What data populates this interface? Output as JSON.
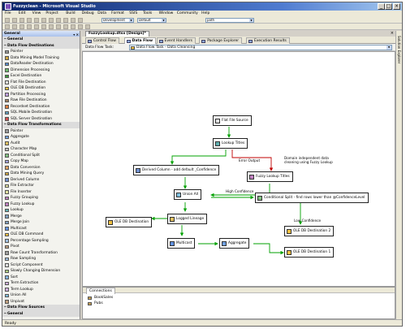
{
  "window": {
    "title": "Fuzzyclean - Microsoft Visual Studio",
    "controls": [
      "_",
      "□",
      "×"
    ]
  },
  "menu": [
    "File",
    "Edit",
    "View",
    "Project",
    "Build",
    "Debug",
    "Data",
    "Format",
    "SSIS",
    "Tools",
    "Window",
    "Community",
    "Help"
  ],
  "toolbar": {
    "config": "Development",
    "platform": "Default",
    "find": "path"
  },
  "toolbox": {
    "title": "General",
    "items": [
      {
        "label": "General",
        "group": true,
        "sign": "−",
        "color": ""
      },
      {
        "label": "Data Flow Destinations",
        "group": true,
        "sign": "−",
        "color": ""
      },
      {
        "label": "Pointer",
        "group": false,
        "color": "#9a9a9a"
      },
      {
        "label": "Data Mining Model Training",
        "group": false,
        "color": "#d0a640"
      },
      {
        "label": "DataReader Destination",
        "group": false,
        "color": "#5a8fd0"
      },
      {
        "label": "Dimension Processing",
        "group": false,
        "color": "#6bbb6b"
      },
      {
        "label": "Excel Destination",
        "group": false,
        "color": "#3c9c3c"
      },
      {
        "label": "Flat File Destination",
        "group": false,
        "color": "#e0e0e0"
      },
      {
        "label": "OLE DB Destination",
        "group": false,
        "color": "#f0c040"
      },
      {
        "label": "Partition Processing",
        "group": false,
        "color": "#c0a0e0"
      },
      {
        "label": "Raw File Destination",
        "group": false,
        "color": "#a08060"
      },
      {
        "label": "Recordset Destination",
        "group": false,
        "color": "#e08040"
      },
      {
        "label": "SQL Mobile Destination",
        "group": false,
        "color": "#60a0c0"
      },
      {
        "label": "SQL Server Destination",
        "group": false,
        "color": "#d05050"
      },
      {
        "label": "Data Flow Transformations",
        "group": true,
        "sign": "−",
        "color": ""
      },
      {
        "label": "Pointer",
        "group": false,
        "color": "#9a9a9a"
      },
      {
        "label": "Aggregate",
        "group": false,
        "color": "#70a0e0"
      },
      {
        "label": "Audit",
        "group": false,
        "color": "#e0c060"
      },
      {
        "label": "Character Map",
        "group": false,
        "color": "#c0c0c0"
      },
      {
        "label": "Conditional Split",
        "group": false,
        "color": "#80c080"
      },
      {
        "label": "Copy Map",
        "group": false,
        "color": "#a0a0e0"
      },
      {
        "label": "Data Conversion",
        "group": false,
        "color": "#e0a060"
      },
      {
        "label": "Data Mining Query",
        "group": false,
        "color": "#d0a640"
      },
      {
        "label": "Derived Column",
        "group": false,
        "color": "#7090d0"
      },
      {
        "label": "File Extractor",
        "group": false,
        "color": "#e0e0a0"
      },
      {
        "label": "File Inserter",
        "group": false,
        "color": "#e0e0a0"
      },
      {
        "label": "Fuzzy Grouping",
        "group": false,
        "color": "#c080c0"
      },
      {
        "label": "Fuzzy Lookup",
        "group": false,
        "color": "#c080c0"
      },
      {
        "label": "Lookup",
        "group": false,
        "color": "#60b0b0"
      },
      {
        "label": "Merge",
        "group": false,
        "color": "#80a0c0"
      },
      {
        "label": "Merge Join",
        "group": false,
        "color": "#80a0c0"
      },
      {
        "label": "Multicast",
        "group": false,
        "color": "#6090e0"
      },
      {
        "label": "OLE DB Command",
        "group": false,
        "color": "#f0c040"
      },
      {
        "label": "Percentage Sampling",
        "group": false,
        "color": "#a0c0e0"
      },
      {
        "label": "Pivot",
        "group": false,
        "color": "#c0a080"
      },
      {
        "label": "Row Count Transformation",
        "group": false,
        "color": "#a0a0a0"
      },
      {
        "label": "Row Sampling",
        "group": false,
        "color": "#a0c0e0"
      },
      {
        "label": "Script Component",
        "group": false,
        "color": "#e0e0e0"
      },
      {
        "label": "Slowly Changing Dimension",
        "group": false,
        "color": "#b0d080"
      },
      {
        "label": "Sort",
        "group": false,
        "color": "#80b0e0"
      },
      {
        "label": "Term Extraction",
        "group": false,
        "color": "#d0b0e0"
      },
      {
        "label": "Term Lookup",
        "group": false,
        "color": "#d0b0e0"
      },
      {
        "label": "Union All",
        "group": false,
        "color": "#80c0e0"
      },
      {
        "label": "Unpivot",
        "group": false,
        "color": "#c0a080"
      },
      {
        "label": "Data Flow Sources",
        "group": true,
        "sign": "−",
        "color": ""
      },
      {
        "label": "General",
        "group": true,
        "sign": "−",
        "color": ""
      }
    ]
  },
  "doc_tab": {
    "label": "FuzzyLookup.dtsx [Design]*",
    "close": "×"
  },
  "designer_tabs": [
    "Control Flow",
    "Data Flow",
    "Event Handlers",
    "Package Explorer",
    "Execution Results"
  ],
  "designer_active": 1,
  "task": {
    "label": "Data Flow Task:",
    "value": "Data Flow Task - Data Cleansing"
  },
  "flow": {
    "nodes": {
      "flat_file_source": "Flat File Source",
      "lookup_titles": "Lookup Titles",
      "derived_column": "Derived Column - add default _Confidence",
      "fuzzy_lookup": "Fuzzy Lookup Titles",
      "union_all": "Union All",
      "conditional_split": "Conditional Split - find rows lower than @ConfidenceLevel",
      "ole_db_dest": "OLE DB Destination",
      "logged_lineage": "Logged Lineage",
      "multicast": "Multicast",
      "aggregate": "Aggregate",
      "ole_db_dest_2": "OLE DB Destination 2",
      "ole_db_dest_1": "OLE DB Destination 1"
    },
    "labels": {
      "error_output": "Error Output",
      "note": "Domain independent data cleaning using Fuzzy Lookup",
      "high_confidence": "High Confidence",
      "low_confidence": "Low Confidence"
    },
    "colors": {
      "data_path": "#00a000",
      "error_path": "#c00000"
    }
  },
  "connections": {
    "title": "Connections",
    "items": [
      "BookSales",
      "Pubs"
    ]
  },
  "right_panel": "Solution Explorer",
  "status": "Ready"
}
